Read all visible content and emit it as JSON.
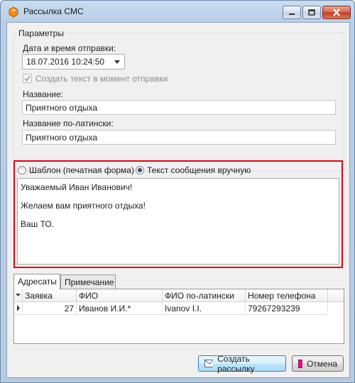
{
  "window": {
    "title": "Рассылка СМС",
    "icon": "orange-hexagon-icon"
  },
  "params": {
    "group_title": "Параметры",
    "datetime_label": "Дата и время отправки:",
    "datetime_value": "18.07.2016 10:24:50",
    "create_text_label": "Создать текст в момент отправки",
    "create_text_checked": true,
    "create_text_enabled": false,
    "name_label": "Название:",
    "name_value": "Приятного отдыха",
    "name_latin_label": "Название по-латински:",
    "name_latin_value": "Приятного отдыха"
  },
  "message": {
    "template_radio_label": "Шаблон (печатная форма)",
    "template_selected": false,
    "manual_radio_label": "Текст сообщения вручную",
    "manual_selected": true,
    "lines": [
      "Уважаемый Иван Иванович!",
      "Желаем вам приятного отдыха!",
      "Ваш ТО."
    ]
  },
  "tabs": {
    "recipients": "Адресаты",
    "notes": "Примечание",
    "active": "recipients"
  },
  "grid": {
    "columns": [
      "Заявка",
      "ФИО",
      "ФИО по-латински",
      "Номер телефона"
    ],
    "rows": [
      {
        "order": "27",
        "fio": "Иванов И.И.*",
        "fio_latin": "Ivanov I.I.",
        "phone": "79267293239"
      }
    ]
  },
  "buttons": {
    "create": "Создать рассылку",
    "cancel": "Отмена"
  },
  "colors": {
    "highlight_frame": "#e3000f",
    "cancel_icon": "#e0138c"
  }
}
